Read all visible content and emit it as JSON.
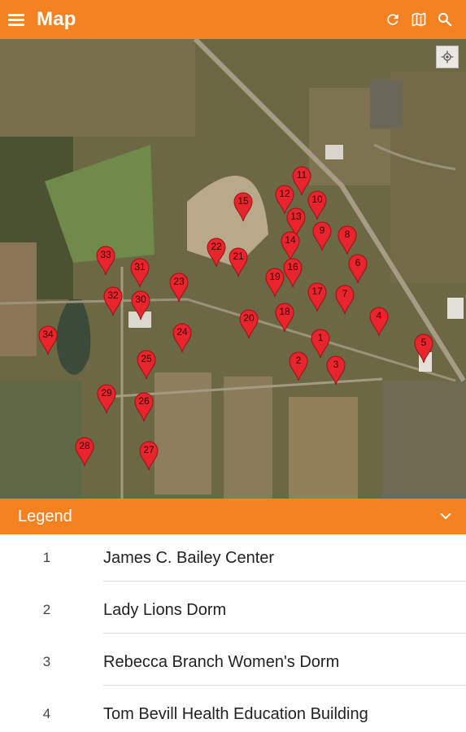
{
  "app": {
    "title": "Map"
  },
  "icons": {
    "menu": "menu-icon",
    "refresh": "refresh-icon",
    "map": "map-icon",
    "search": "search-icon",
    "locate": "locate-icon",
    "chevron": "chevron-down-icon"
  },
  "colors": {
    "accent": "#f58220",
    "pin": "#e8242c"
  },
  "map": {
    "pins": [
      "1",
      "2",
      "3",
      "4",
      "5",
      "6",
      "7",
      "8",
      "9",
      "10",
      "11",
      "12",
      "13",
      "14",
      "15",
      "16",
      "17",
      "18",
      "19",
      "20",
      "21",
      "22",
      "23",
      "24",
      "25",
      "26",
      "27",
      "28",
      "29",
      "30",
      "31",
      "32",
      "33",
      "34"
    ]
  },
  "legend": {
    "title": "Legend",
    "items": [
      {
        "number": "1",
        "name": "James C. Bailey Center"
      },
      {
        "number": "2",
        "name": "Lady Lions Dorm"
      },
      {
        "number": "3",
        "name": "Rebecca Branch Women's Dorm"
      },
      {
        "number": "4",
        "name": "Tom Bevill Health Education Building"
      }
    ]
  }
}
